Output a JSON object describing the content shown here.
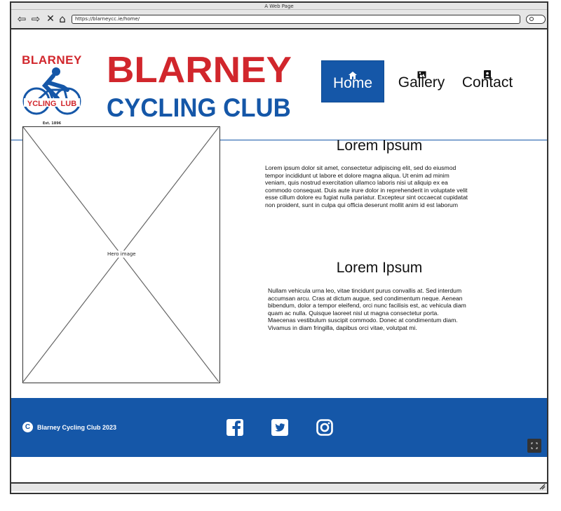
{
  "browser": {
    "window_title": "A Web Page",
    "url": "https://blarneycc.ie/home/"
  },
  "header": {
    "logo": {
      "top_text": "BLARNEY",
      "ring_text": "YCLING  LUB",
      "est_text": "Est. 1896"
    },
    "title_line1": "BLARNEY",
    "title_line2": "CYCLING CLUB",
    "nav": [
      {
        "label": "Home",
        "icon": "home-icon",
        "active": true
      },
      {
        "label": "Gallery",
        "icon": "image-icon",
        "active": false
      },
      {
        "label": "Contact",
        "icon": "contact-card-icon",
        "active": false
      }
    ]
  },
  "main": {
    "hero_label": "Hero image",
    "sections": [
      {
        "heading": "Lorem Ipsum",
        "lines": [
          "Lorem ipsum dolor sit amet, consectetur adipiscing elit, sed do eiusmod",
          "tempor incididunt ut labore et dolore magna aliqua. Ut enim ad minim",
          "veniam, quis nostrud exercitation ullamco laboris nisi ut aliquip ex ea",
          "commodo consequat. Duis aute irure dolor in reprehenderit in voluptate velit",
          "esse cillum dolore eu fugiat nulla pariatur. Excepteur sint occaecat cupidatat",
          "non proident, sunt in culpa qui officia deserunt mollit anim id est laborum"
        ]
      },
      {
        "heading": "Lorem Ipsum",
        "lines": [
          "Nullam vehicula urna leo, vitae tincidunt purus convallis at. Sed interdum",
          "accumsan arcu. Cras at dictum augue, sed condimentum neque. Aenean",
          "bibendum, dolor a tempor eleifend, orci nunc facilisis est, ac vehicula diam",
          "quam ac nulla. Quisque laoreet nisl ut magna consectetur porta.",
          "Maecenas vestibulum suscipit commodo. Donec at condimentum diam.",
          "Vivamus in diam fringilla, dapibus orci vitae, volutpat mi."
        ]
      }
    ]
  },
  "footer": {
    "copyright": "Blarney Cycling Club 2023",
    "social": [
      "facebook-icon",
      "twitter-icon",
      "instagram-icon"
    ]
  },
  "colors": {
    "brand_blue": "#1557a8",
    "brand_red": "#d1262c"
  }
}
